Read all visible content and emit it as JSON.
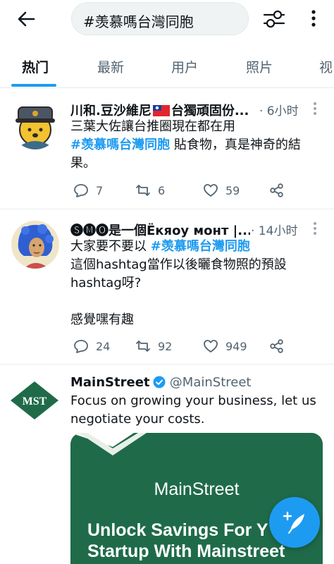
{
  "header": {
    "search_value": "#羡慕嗎台灣同胞"
  },
  "tabs": [
    {
      "label": "热门",
      "active": true
    },
    {
      "label": "最新",
      "active": false
    },
    {
      "label": "用户",
      "active": false
    },
    {
      "label": "照片",
      "active": false
    },
    {
      "label": "视",
      "active": false
    }
  ],
  "tweets": [
    {
      "display_name_before_flag": "川和.豆沙維尼",
      "display_name_after_flag": "台獨頑固份...",
      "time": "· 6小时",
      "text_1": "三葉大佐讓台推圈現在都在用",
      "hashtag": "#羡慕嗎台灣同胞",
      "text_2": " 貼食物，真是神奇的結果。",
      "replies": "7",
      "retweets": "6",
      "likes": "59"
    },
    {
      "display_name": "🅢🅜🅞是一個Ёкяоу монт |...",
      "time": "· 14小时",
      "text_1": "大家要不要以 ",
      "hashtag": "#羡慕嗎台灣同胞",
      "text_2": "這個hashtag當作以後曬食物照的預設hashtag呀?\n\n感覺嘿有趣",
      "replies": "24",
      "retweets": "92",
      "likes": "949"
    },
    {
      "display_name": "MainStreet",
      "handle": "@MainStreet",
      "text": "Focus on growing your business, let us negotiate your costs.",
      "avatar_logo_text": "MST",
      "promo_brand": "MainStreet",
      "promo_line_1": "Unlock Savings For Y",
      "promo_line_2": "Startup With Mainstreet"
    }
  ],
  "icons": {
    "back": "arrow-left-icon",
    "filter": "sliders-icon",
    "more": "more-vertical-icon",
    "reply": "speech-bubble-icon",
    "retweet": "retweet-icon",
    "like": "heart-icon",
    "share": "share-icon",
    "compose": "feather-plus-icon"
  },
  "colors": {
    "accent": "#1d9bf0",
    "secondary_text": "#536471",
    "brand_green": "#1f6b49"
  }
}
